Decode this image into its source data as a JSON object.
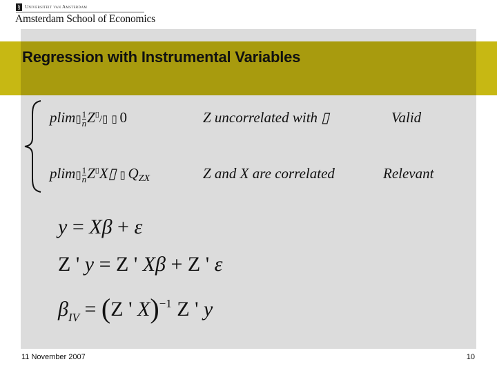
{
  "header": {
    "logo_icon_glyph": "§",
    "university": "Universiteit van Amsterdam",
    "school": "Amsterdam School of Economics"
  },
  "slide": {
    "title": "Regression with Instrumental Variables",
    "conditions": [
      {
        "plim": "plim",
        "missing": "▯",
        "frac_num": "1",
        "frac_den": "n",
        "expr_z": "Z",
        "expr_tail": "/▯",
        "arrow_boxes": "▯  ",
        "result": "0",
        "description": "Z uncorrelated with ▯",
        "property": "Valid"
      },
      {
        "plim": "plim",
        "missing": "▯",
        "frac_num": "1",
        "frac_den": "n",
        "expr_z": "Z",
        "expr_tail": "X▯",
        "arrow_boxes": "▯  ",
        "result": "Q",
        "result_sub": "ZX",
        "description": "Z and X are correlated",
        "property": "Relevant"
      }
    ],
    "equations": {
      "eq1": {
        "lhs": "y",
        "eq": " = ",
        "rhs1": "Xβ",
        "plus": " + ",
        "rhs2": "ε"
      },
      "eq2": {
        "lhs_z": "Z",
        "lhs_prime": " ' ",
        "lhs_y": "y",
        "eq": " = ",
        "z1": "Z",
        "p1": " ' ",
        "xb": "Xβ",
        "plus": " + ",
        "z2": "Z",
        "p2": " ' ",
        "eps": "ε"
      },
      "eq3": {
        "beta": "β",
        "beta_sub": "IV",
        "eq": " = ",
        "lparen": "(",
        "z": "Z",
        "prime": " ' ",
        "x": "X",
        "rparen": ")",
        "exp": "−1",
        "z2": " Z",
        "prime2": " ' ",
        "y": "y"
      }
    }
  },
  "footer": {
    "date": "11 November 2007",
    "page_number": "10"
  }
}
